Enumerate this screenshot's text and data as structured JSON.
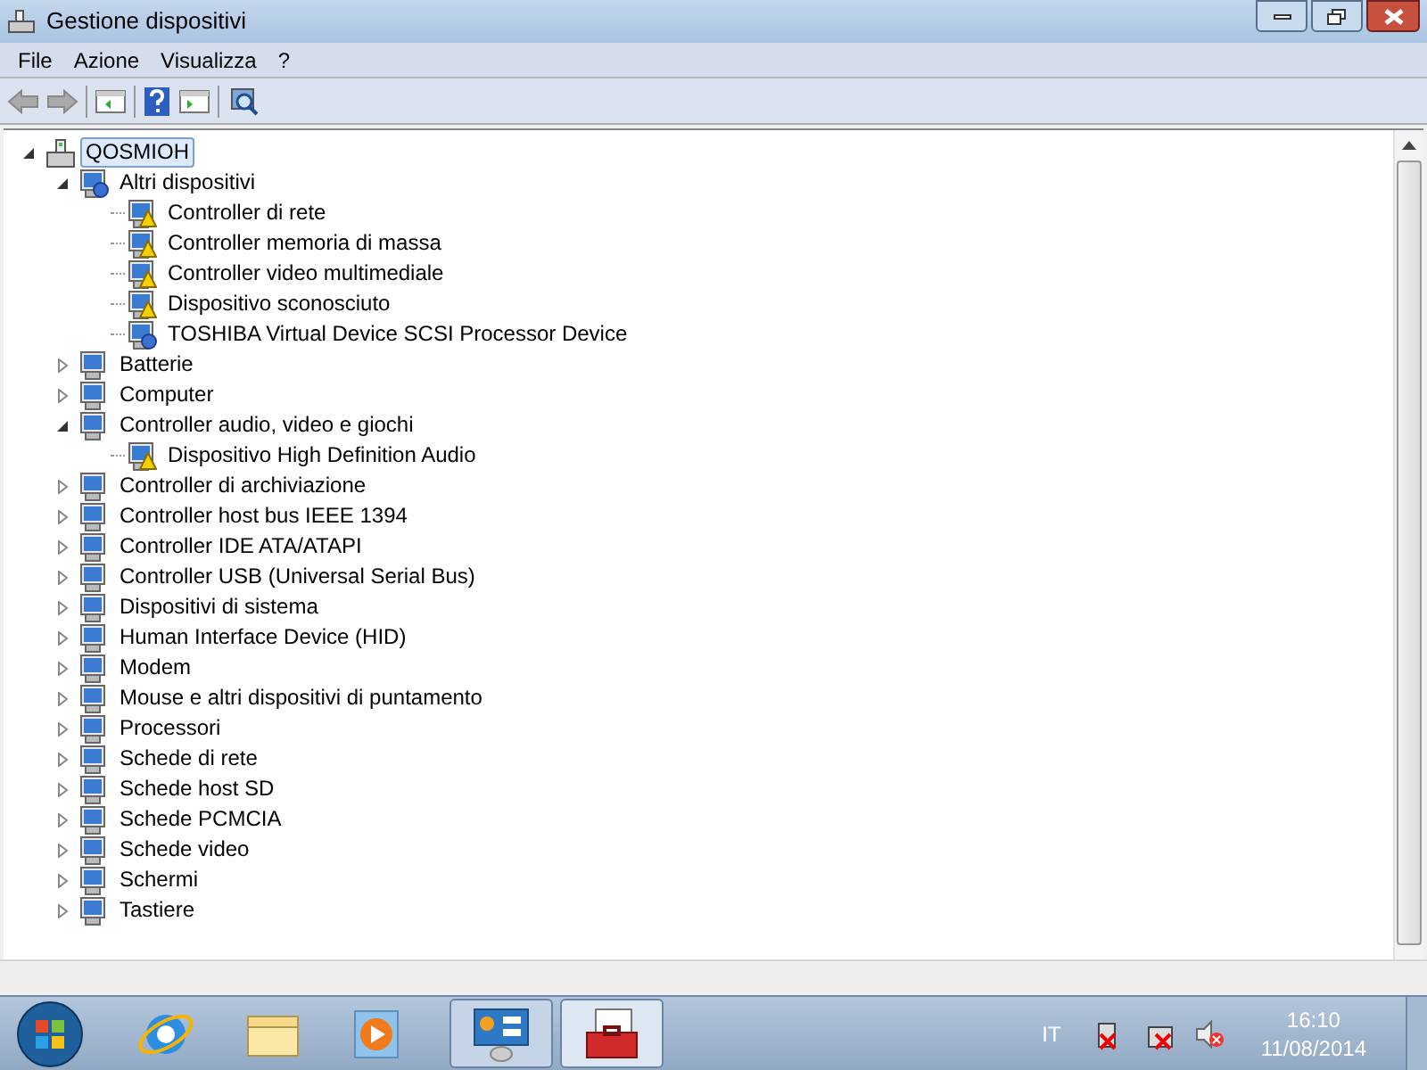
{
  "window": {
    "title": "Gestione dispositivi"
  },
  "menu": [
    "File",
    "Azione",
    "Visualizza",
    "?"
  ],
  "tree": {
    "label": "QOSMIOH",
    "kind": "computer",
    "selected": true,
    "expanded": true,
    "children": [
      {
        "label": "Altri dispositivi",
        "kind": "unknown",
        "expanded": true,
        "children": [
          {
            "label": "Controller di rete",
            "kind": "warning"
          },
          {
            "label": "Controller memoria di massa",
            "kind": "warning"
          },
          {
            "label": "Controller video multimediale",
            "kind": "warning"
          },
          {
            "label": "Dispositivo sconosciuto",
            "kind": "warning"
          },
          {
            "label": "TOSHIBA Virtual Device SCSI Processor Device",
            "kind": "unknown"
          }
        ]
      },
      {
        "label": "Batterie",
        "kind": "device",
        "expanded": false
      },
      {
        "label": "Computer",
        "kind": "device",
        "expanded": false
      },
      {
        "label": "Controller audio, video e giochi",
        "kind": "device",
        "expanded": true,
        "children": [
          {
            "label": "Dispositivo High Definition Audio",
            "kind": "warning"
          }
        ]
      },
      {
        "label": "Controller di archiviazione",
        "kind": "device",
        "expanded": false
      },
      {
        "label": "Controller host bus IEEE 1394",
        "kind": "device",
        "expanded": false
      },
      {
        "label": "Controller IDE ATA/ATAPI",
        "kind": "device",
        "expanded": false
      },
      {
        "label": "Controller USB (Universal Serial Bus)",
        "kind": "device",
        "expanded": false
      },
      {
        "label": "Dispositivi di sistema",
        "kind": "device",
        "expanded": false
      },
      {
        "label": "Human Interface Device (HID)",
        "kind": "device",
        "expanded": false
      },
      {
        "label": "Modem",
        "kind": "device",
        "expanded": false
      },
      {
        "label": "Mouse e altri dispositivi di puntamento",
        "kind": "device",
        "expanded": false
      },
      {
        "label": "Processori",
        "kind": "device",
        "expanded": false
      },
      {
        "label": "Schede di rete",
        "kind": "device",
        "expanded": false
      },
      {
        "label": "Schede host SD",
        "kind": "device",
        "expanded": false
      },
      {
        "label": "Schede PCMCIA",
        "kind": "device",
        "expanded": false
      },
      {
        "label": "Schede video",
        "kind": "device",
        "expanded": false
      },
      {
        "label": "Schermi",
        "kind": "device",
        "expanded": false
      },
      {
        "label": "Tastiere",
        "kind": "device",
        "expanded": false
      }
    ]
  },
  "taskbar": {
    "language": "IT",
    "time": "16:10",
    "date": "11/08/2014"
  }
}
